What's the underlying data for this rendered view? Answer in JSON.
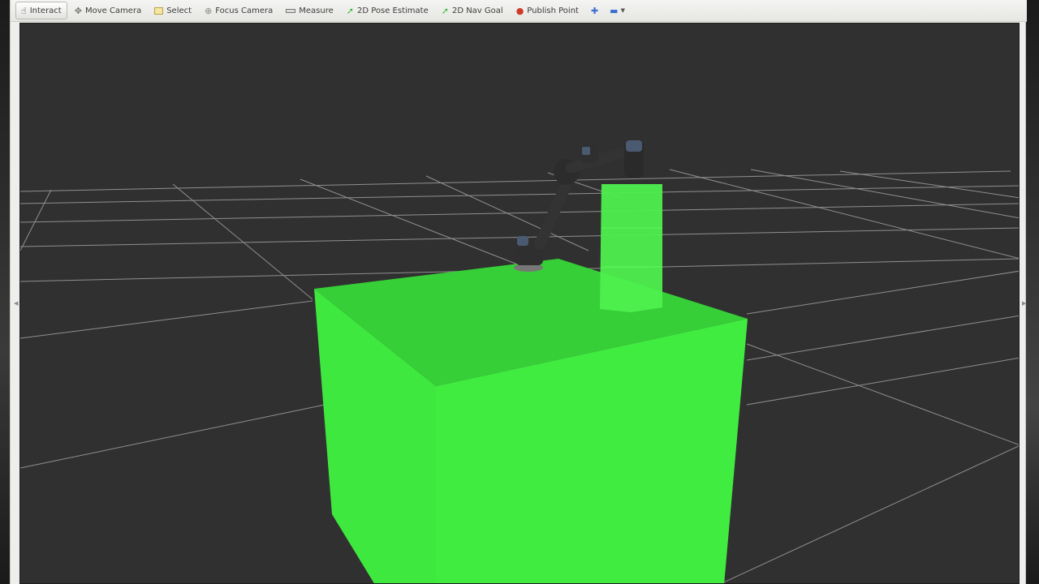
{
  "toolbar": {
    "tools": [
      {
        "id": "interact",
        "label": "Interact",
        "icon": "hand-cursor-icon",
        "active": true
      },
      {
        "id": "move-camera",
        "label": "Move Camera",
        "icon": "move-arrows-icon",
        "active": false
      },
      {
        "id": "select",
        "label": "Select",
        "icon": "selection-box-icon",
        "active": false
      },
      {
        "id": "focus-camera",
        "label": "Focus Camera",
        "icon": "crosshair-icon",
        "active": false
      },
      {
        "id": "measure",
        "label": "Measure",
        "icon": "ruler-icon",
        "active": false
      },
      {
        "id": "pose-estimate",
        "label": "2D Pose Estimate",
        "icon": "green-arrow-icon",
        "active": false
      },
      {
        "id": "nav-goal",
        "label": "2D Nav Goal",
        "icon": "green-arrow-icon",
        "active": false
      },
      {
        "id": "publish-point",
        "label": "Publish Point",
        "icon": "map-pin-icon",
        "active": false
      }
    ],
    "add_tool_icon": "plus-icon",
    "remove_tool_icon": "minus-icon"
  },
  "colors": {
    "viewport_bg": "#303030",
    "grid_line": "#a0a0a0",
    "box_front": "#3fe83f",
    "box_top": "#37cf37",
    "box_side": "#45f045",
    "stack": "#4cf04c",
    "robot": "#2f2f2f",
    "robot_joint": "#4a5a70",
    "pin": "#cc3a2a",
    "arrow": "#38b838"
  }
}
